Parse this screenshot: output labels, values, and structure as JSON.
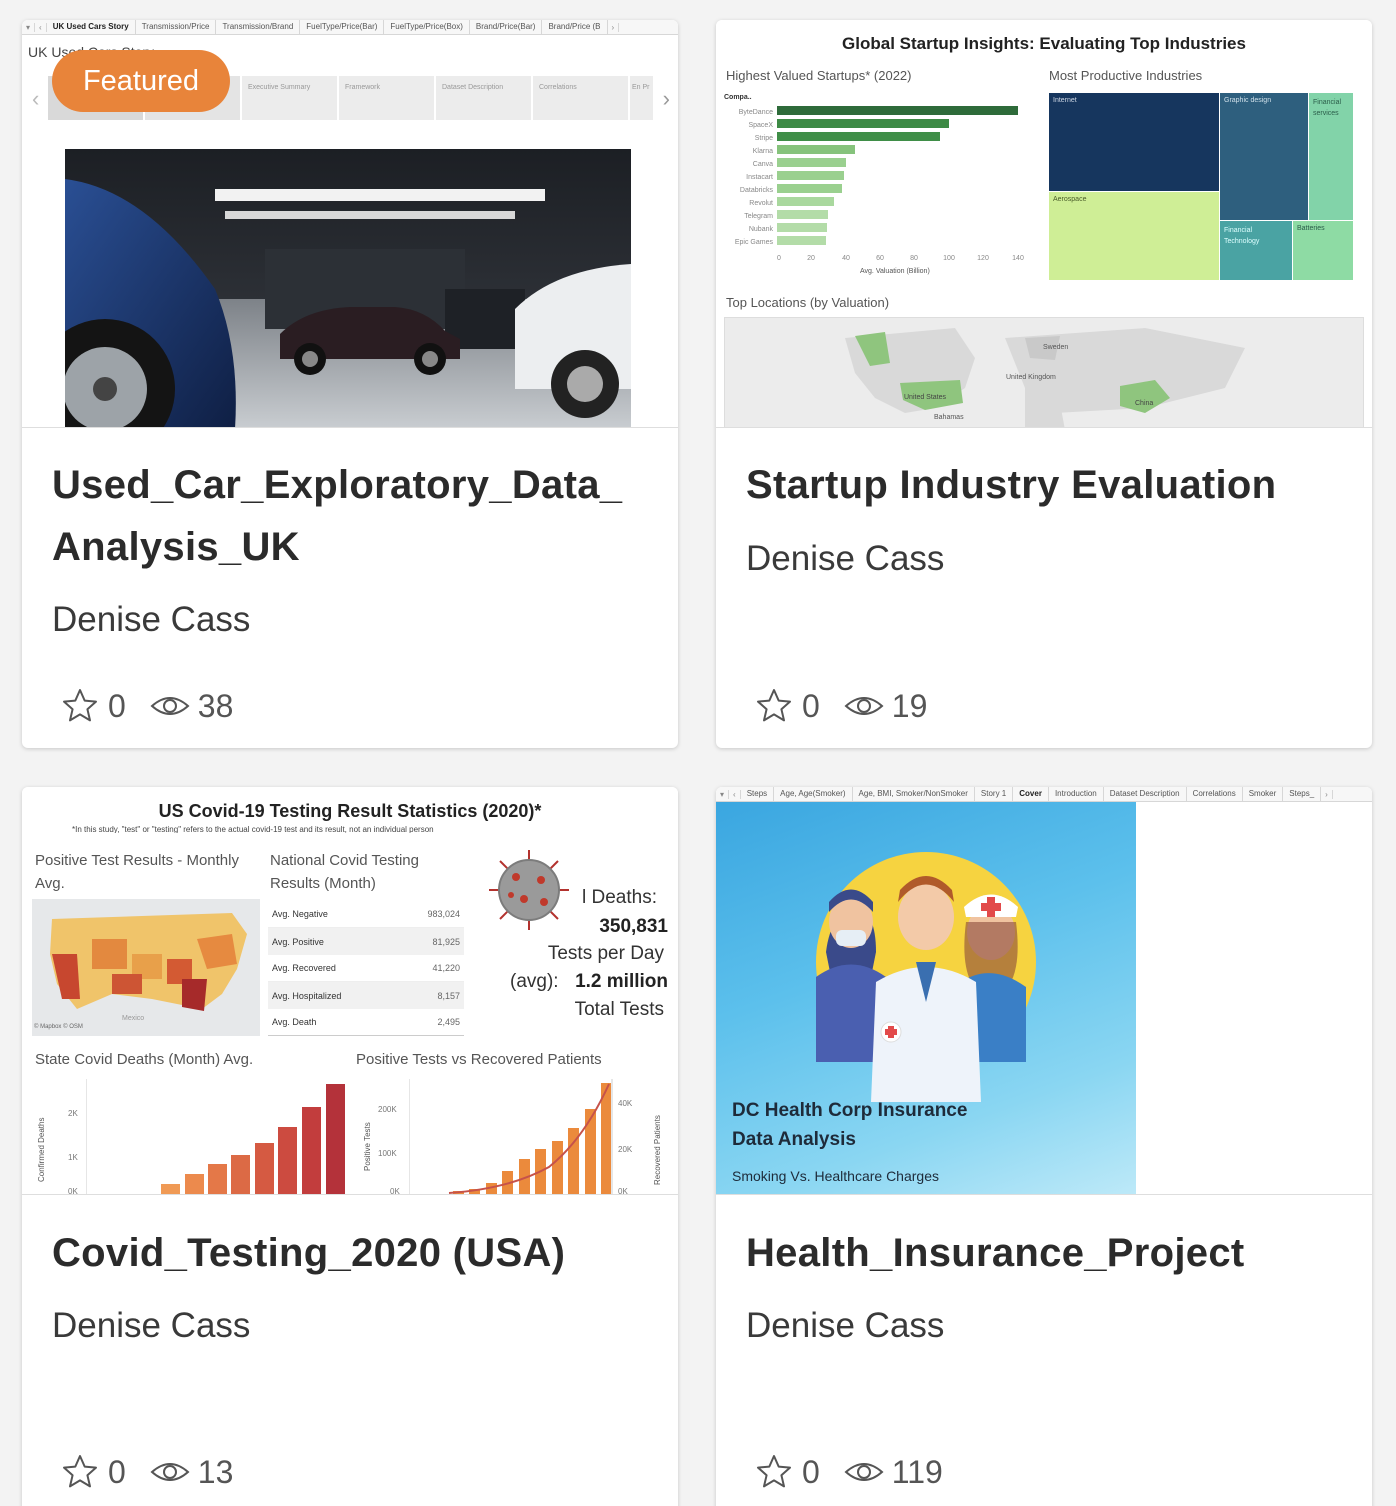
{
  "cards": [
    {
      "title": "Used_Car_Exploratory_Data_ Analysis_UK",
      "author": "Denise Cass",
      "favorites": "0",
      "views": "38",
      "badge": "Featured",
      "thumb": {
        "tabs": [
          "UK Used Cars Story",
          "Transmission/Price",
          "Transmission/Brand",
          "FuelType/Price(Bar)",
          "FuelType/Price(Box)",
          "Brand/Price(Bar)",
          "Brand/Price (B"
        ],
        "story_title": "UK Used Cars Story",
        "story_points": [
          "",
          "",
          "Executive Summary",
          "Framework",
          "Dataset Description",
          "Correlations",
          "En Pr"
        ]
      }
    },
    {
      "title": "Startup Industry Evaluation",
      "author": "Denise Cass",
      "favorites": "0",
      "views": "19",
      "thumb": {
        "heading": "Global Startup Insights: Evaluating Top Industries",
        "bar_title": "Highest Valued Startups* (2022)",
        "bar_col_header": "Compa..",
        "bar_xlabel": "Avg. Valuation (Billion)",
        "treemap_title": "Most Productive Industries",
        "map_title": "Top Locations (by Valuation)",
        "map_labels": [
          "Sweden",
          "United Kingdom",
          "United States",
          "Bahamas",
          "China"
        ],
        "treemap_cells": [
          "Internet",
          "Graphic design",
          "Financial services",
          "Aerospace",
          "Financial Technology",
          "Batteries"
        ]
      }
    },
    {
      "title": "Covid_Testing_2020 (USA)",
      "author": "Denise Cass",
      "favorites": "0",
      "views": "13",
      "thumb": {
        "heading": "US Covid-19 Testing Result Statistics (2020)*",
        "note": "*In this study, \"test\" or \"testing\" refers to the actual covid-19 test and its result, not an individual person",
        "map_title": "Positive Test Results - Monthly Avg.",
        "map_credit": "© Mapbox  © OSM",
        "map_country": "Mexico",
        "table_title": "National Covid Testing Results (Month)",
        "table_rows": [
          {
            "label": "Avg. Negative",
            "value": "983,024"
          },
          {
            "label": "Avg. Positive",
            "value": "81,925"
          },
          {
            "label": "Avg. Recovered",
            "value": "41,220"
          },
          {
            "label": "Avg. Hospitalized",
            "value": "8,157"
          },
          {
            "label": "Avg. Death",
            "value": "2,495"
          }
        ],
        "kpi_deaths_label": "l Deaths:",
        "kpi_deaths_value": "350,831",
        "kpi_tests_label_1": "Tests per Day",
        "kpi_tests_label_2": "(avg):",
        "kpi_tests_value": "1.2 million",
        "kpi_total_label": "Total Tests",
        "deaths_chart_title": "State Covid Deaths (Month) Avg.",
        "deaths_ylabel": "Confirmed Deaths",
        "deaths_ticks": [
          "2K",
          "1K",
          "0K"
        ],
        "pos_chart_title": "Positive Tests vs Recovered Patients",
        "pos_ylabel": "Positive Tests",
        "pos_ticks": [
          "200K",
          "100K",
          "0K"
        ],
        "rec_ylabel": "Recovered Patients",
        "rec_ticks": [
          "40K",
          "20K",
          "0K"
        ]
      }
    },
    {
      "title": "Health_Insurance_Project",
      "author": "Denise Cass",
      "favorites": "0",
      "views": "119",
      "thumb": {
        "tabs": [
          "Steps",
          "Age, Age(Smoker)",
          "Age, BMI, Smoker/NonSmoker",
          "Story 1",
          "Cover",
          "Introduction",
          "Dataset Description",
          "Correlations",
          "Smoker",
          "Steps_"
        ],
        "line1": "DC Health Corp Insurance",
        "line2": "Data Analysis",
        "subtitle": "Smoking Vs. Healthcare Charges"
      }
    }
  ]
}
